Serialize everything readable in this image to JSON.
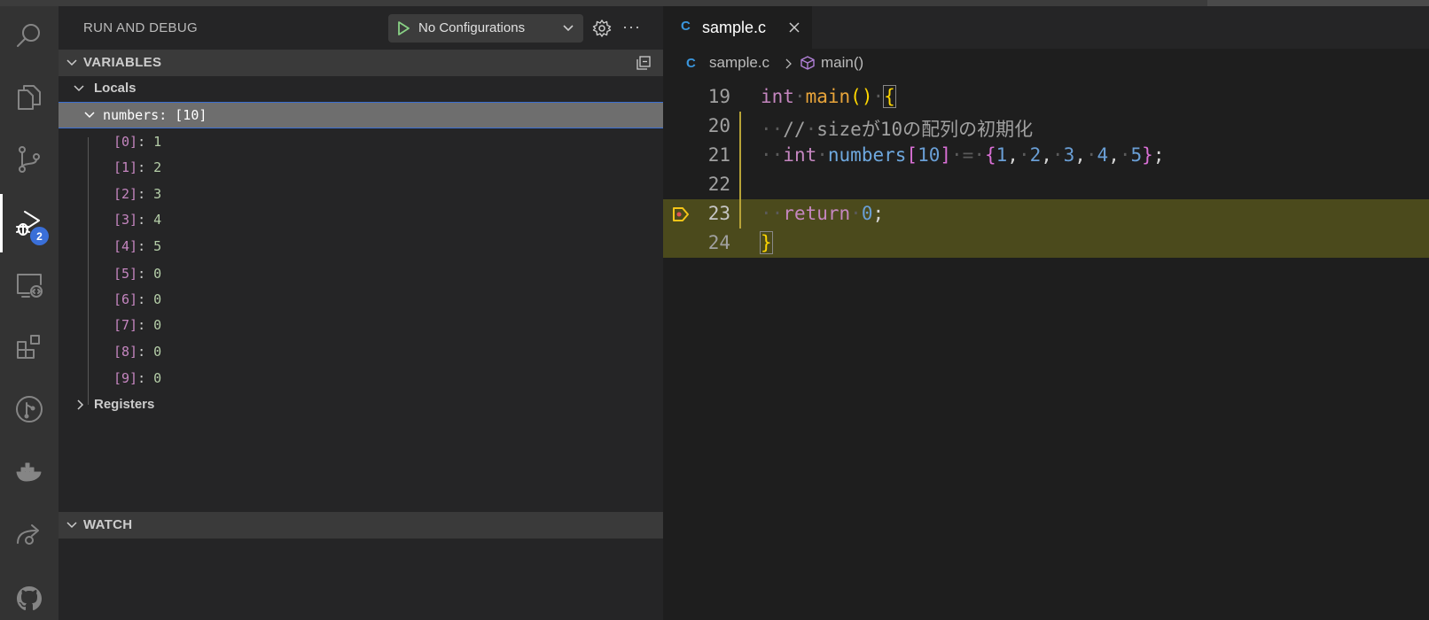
{
  "activity_bar": {
    "items": [
      {
        "name": "search-icon"
      },
      {
        "name": "explorer-icon"
      },
      {
        "name": "source-control-icon"
      },
      {
        "name": "run-debug-icon",
        "badge": "2"
      },
      {
        "name": "remote-explorer-icon"
      },
      {
        "name": "extensions-icon"
      },
      {
        "name": "git-graph-icon"
      },
      {
        "name": "docker-icon"
      },
      {
        "name": "live-share-icon"
      },
      {
        "name": "github-icon"
      }
    ]
  },
  "sidebar": {
    "title": "RUN AND DEBUG",
    "config_label": "No Configurations",
    "variables_header": "VARIABLES",
    "locals_label": "Locals",
    "numbers_label": "numbers: [10]",
    "array_items": [
      {
        "name": "[0]",
        "value": "1"
      },
      {
        "name": "[1]",
        "value": "2"
      },
      {
        "name": "[2]",
        "value": "3"
      },
      {
        "name": "[3]",
        "value": "4"
      },
      {
        "name": "[4]",
        "value": "5"
      },
      {
        "name": "[5]",
        "value": "0"
      },
      {
        "name": "[6]",
        "value": "0"
      },
      {
        "name": "[7]",
        "value": "0"
      },
      {
        "name": "[8]",
        "value": "0"
      },
      {
        "name": "[9]",
        "value": "0"
      }
    ],
    "registers_label": "Registers",
    "watch_header": "WATCH"
  },
  "editor": {
    "tab_icon": "C",
    "tab_name": "sample.c",
    "breadcrumb_icon": "C",
    "breadcrumb_file": "sample.c",
    "breadcrumb_symbol": "main()",
    "line_numbers": [
      "19",
      "20",
      "21",
      "22",
      "23",
      "24"
    ],
    "current_line": "23"
  },
  "colors": {
    "accent": "#3a6fd8",
    "current_line_bg": "#4b4a1c",
    "debug_arrow": "#f5c518"
  }
}
